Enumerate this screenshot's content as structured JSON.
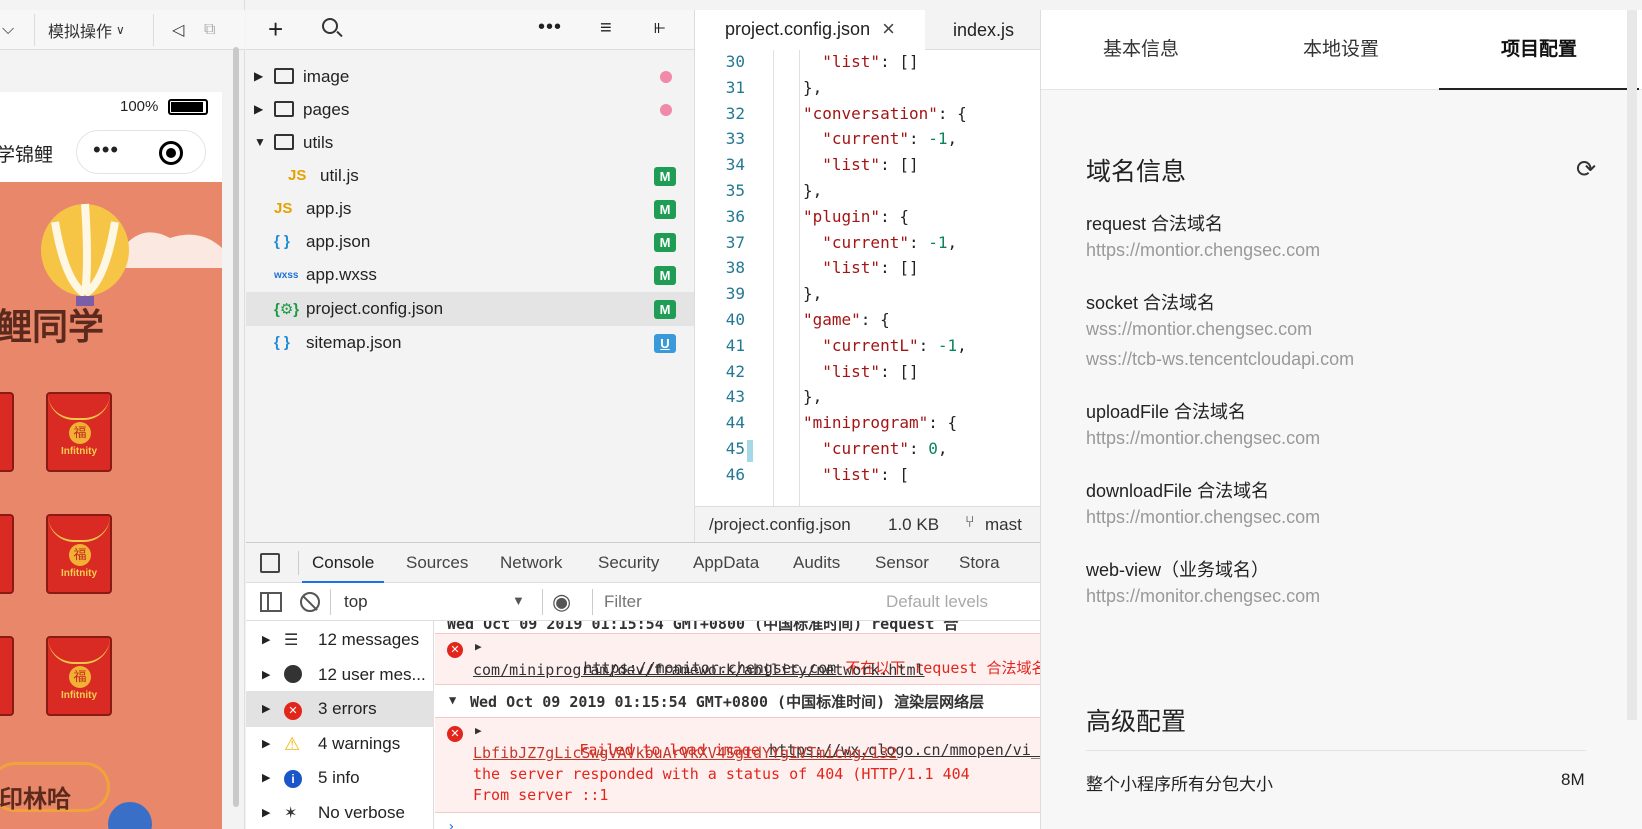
{
  "simulator": {
    "toolbar": {
      "mode_label": "模拟操作"
    },
    "status": {
      "battery": "100%"
    },
    "nav": {
      "title_fragment": "学锦鲤"
    },
    "page": {
      "heading_fragment": "鲤同学",
      "bottom_fragment": "印林哈",
      "envelope_label": "Infitnity",
      "envelope_char": "福"
    }
  },
  "files": {
    "items": [
      {
        "name": "image",
        "type": "folder",
        "status": "dot"
      },
      {
        "name": "pages",
        "type": "folder",
        "status": "dot"
      },
      {
        "name": "utils",
        "type": "folder-open",
        "status": ""
      },
      {
        "name": "util.js",
        "type": "js",
        "status": "M"
      },
      {
        "name": "app.js",
        "type": "js",
        "status": "M"
      },
      {
        "name": "app.json",
        "type": "json",
        "status": "M"
      },
      {
        "name": "app.wxss",
        "type": "wxss",
        "status": "M"
      },
      {
        "name": "project.config.json",
        "type": "config",
        "status": "M",
        "selected": true
      },
      {
        "name": "sitemap.json",
        "type": "json",
        "status": "U"
      }
    ],
    "icon_js": "JS",
    "icon_json": "{ }",
    "icon_wxss": "wxss",
    "icon_config": "{⚙}"
  },
  "editor": {
    "tabs": [
      {
        "label": "project.config.json",
        "active": true
      },
      {
        "label": "index.js",
        "active": false
      }
    ],
    "lines": [
      {
        "n": "30",
        "text": "  \"list\": []"
      },
      {
        "n": "31",
        "text": "},"
      },
      {
        "n": "32",
        "text": "\"conversation\": {"
      },
      {
        "n": "33",
        "text": "  \"current\": -1,"
      },
      {
        "n": "34",
        "text": "  \"list\": []"
      },
      {
        "n": "35",
        "text": "},"
      },
      {
        "n": "36",
        "text": "\"plugin\": {"
      },
      {
        "n": "37",
        "text": "  \"current\": -1,"
      },
      {
        "n": "38",
        "text": "  \"list\": []"
      },
      {
        "n": "39",
        "text": "},"
      },
      {
        "n": "40",
        "text": "\"game\": {"
      },
      {
        "n": "41",
        "text": "  \"currentL\": -1,"
      },
      {
        "n": "42",
        "text": "  \"list\": []"
      },
      {
        "n": "43",
        "text": "},"
      },
      {
        "n": "44",
        "text": "\"miniprogram\": {"
      },
      {
        "n": "45",
        "text": "  \"current\": 0,"
      },
      {
        "n": "46",
        "text": "  \"list\": ["
      }
    ],
    "status": {
      "path": "/project.config.json",
      "size": "1.0 KB",
      "branch": "mast"
    }
  },
  "console": {
    "tabs": [
      "Console",
      "Sources",
      "Network",
      "Security",
      "AppData",
      "Audits",
      "Sensor",
      "Stora"
    ],
    "context": "top",
    "filter_placeholder": "Filter",
    "levels": "Default levels",
    "sidebar": [
      {
        "label": "12 messages",
        "icon": "list-icon"
      },
      {
        "label": "12 user mes...",
        "icon": "user-icon"
      },
      {
        "label": "3 errors",
        "icon": "error-icon",
        "selected": true
      },
      {
        "label": "4 warnings",
        "icon": "warning-icon"
      },
      {
        "label": "5 info",
        "icon": "info-icon"
      },
      {
        "label": "No verbose",
        "icon": "bug-icon"
      }
    ],
    "messages": {
      "partial_header": "Wed Oct 09 2019 01:15:54 GMT+0800 (中国标准时间) request 合",
      "err1_url": "https://monitor.chengsec.com",
      "err1_text": " 不在以下 request 合法域名列",
      "err1_line2": "com/miniprogram/dev/framework/ability/network.html",
      "group_header": "Wed Oct 09 2019 01:15:54 GMT+0800 (中国标准时间) 渲染层网络层",
      "err2_prefix": "Failed to load image ",
      "err2_url": "https://wx.qlogo.cn/mmopen/vi_32/",
      "err2_line2": "LbfibJZ7gLicSwgVAVkbuArVkXV4SgtdYYgIVTmicng/132",
      "err2_line3": "the server responded with a status of 404 (HTTP/1.1 404",
      "err2_line4": "From server ::1"
    }
  },
  "panel": {
    "tabs": [
      {
        "label": "基本信息",
        "active": false
      },
      {
        "label": "本地设置",
        "active": false
      },
      {
        "label": "项目配置",
        "active": true
      }
    ],
    "domain_section": {
      "title": "域名信息",
      "fields": [
        {
          "label": "request 合法域名",
          "values": [
            "https://montior.chengsec.com"
          ]
        },
        {
          "label": "socket 合法域名",
          "values": [
            "wss://montior.chengsec.com",
            "wss://tcb-ws.tencentcloudapi.com"
          ]
        },
        {
          "label": "uploadFile 合法域名",
          "values": [
            "https://montior.chengsec.com"
          ]
        },
        {
          "label": "downloadFile 合法域名",
          "values": [
            "https://montior.chengsec.com"
          ]
        },
        {
          "label": "web-view（业务域名）",
          "values": [
            "https://monitor.chengsec.com"
          ]
        }
      ]
    },
    "advanced_section": {
      "title": "高级配置",
      "row_label": "整个小程序所有分包大小",
      "row_value": "8M"
    }
  }
}
